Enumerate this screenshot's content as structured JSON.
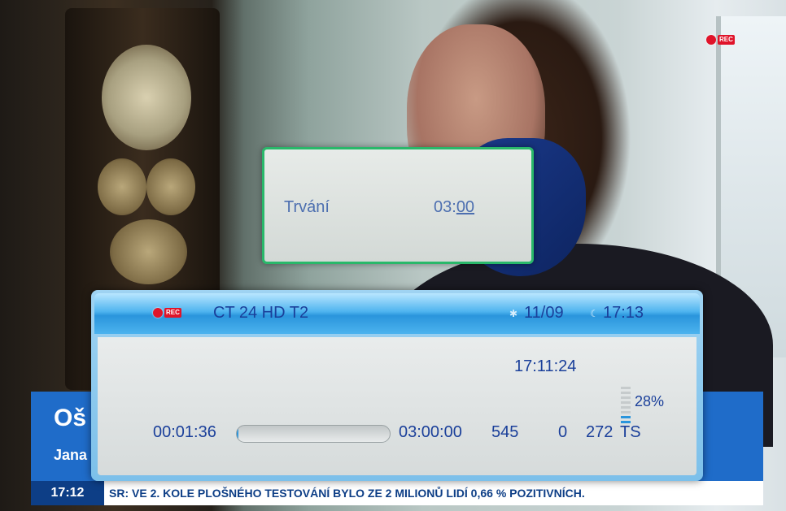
{
  "colors": {
    "header_blue": "#2a95dc",
    "text_blue": "#1a3f9a",
    "dialog_border": "#29b86a",
    "record_red": "#e0142a",
    "news_blue": "#1f6cc9"
  },
  "recording_indicator": {
    "icon": "record-icon",
    "tag": "REC"
  },
  "duration_dialog": {
    "label": "Trvání",
    "value_prefix": "03:",
    "value_cursor": "00"
  },
  "info_panel": {
    "channel": "CT 24 HD T2",
    "date_icon": "satellite-icon",
    "date": "11/09",
    "clock_icon": "clock-icon",
    "time": "17:13",
    "current_time": "17:11:24",
    "elapsed": "00:01:36",
    "total": "03:00:00",
    "progress_fraction": 0.0089,
    "stat_a": "545",
    "stat_b": "0",
    "stat_c": "272",
    "stat_d": "TS",
    "buffer_percent": "28%",
    "buffer_fraction": 0.28
  },
  "broadcast": {
    "lower_title": "Oš",
    "lower_name": "Jana",
    "ticker_time": "17:12",
    "ticker_text": "SR: VE 2. KOLE PLOŠNÉHO TESTOVÁNÍ BYLO ZE 2 MILIONŮ LIDÍ 0,66 % POZITIVNÍCH."
  }
}
